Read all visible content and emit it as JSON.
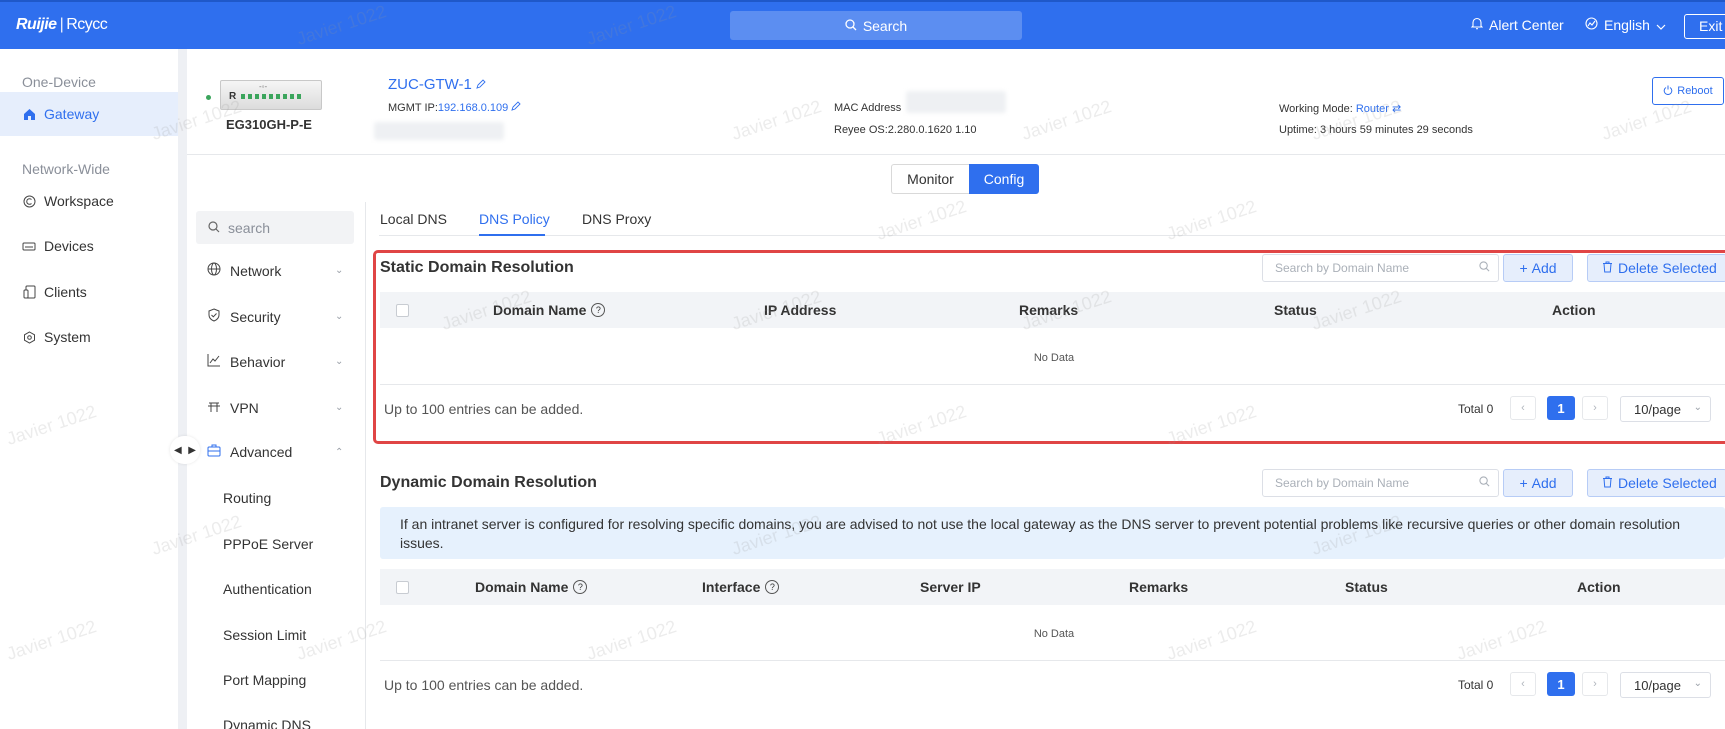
{
  "header": {
    "logo_brand": "Ruijie",
    "logo_sep": "|",
    "logo_sub": "Rcycc",
    "search_label": "Search",
    "alert_center": "Alert Center",
    "language": "English",
    "exit": "Exit"
  },
  "sidebar": {
    "group_one": "One-Device",
    "gateway": "Gateway",
    "group_network": "Network-Wide",
    "workspace": "Workspace",
    "devices": "Devices",
    "clients": "Clients",
    "system": "System"
  },
  "device": {
    "model": "EG310GH-P-E",
    "name": "ZUC-GTW-1",
    "mgmt_ip_label": "MGMT IP:",
    "mgmt_ip": "192.168.0.109",
    "mac_label": "MAC Address",
    "os_version": "Reyee OS:2.280.0.1620 1.10",
    "working_mode_label": "Working Mode:",
    "working_mode": "Router",
    "uptime": "Uptime: 3 hours 59 minutes 29 seconds",
    "reboot": "Reboot"
  },
  "mode_switch": {
    "monitor": "Monitor",
    "config": "Config"
  },
  "menu": {
    "search_placeholder": "search",
    "network": "Network",
    "security": "Security",
    "behavior": "Behavior",
    "vpn": "VPN",
    "advanced": "Advanced",
    "routing": "Routing",
    "pppoe": "PPPoE Server",
    "authentication": "Authentication",
    "session_limit": "Session Limit",
    "port_mapping": "Port Mapping",
    "dynamic_dns": "Dynamic DNS"
  },
  "tabs": {
    "local_dns": "Local DNS",
    "dns_policy": "DNS Policy",
    "dns_proxy": "DNS Proxy"
  },
  "static": {
    "title": "Static Domain Resolution",
    "search_placeholder": "Search by Domain Name",
    "add": "Add",
    "delete": "Delete Selected",
    "columns": [
      "Domain Name",
      "IP Address",
      "Remarks",
      "Status",
      "Action"
    ],
    "no_data": "No Data",
    "limit_note": "Up to 100 entries can be added.",
    "total": "Total 0",
    "page": "1",
    "page_size": "10/page"
  },
  "dynamic": {
    "title": "Dynamic Domain Resolution",
    "search_placeholder": "Search by Domain Name",
    "add": "Add",
    "delete": "Delete Selected",
    "info": "If an intranet server is configured for resolving specific domains, you are advised to not use the local gateway as the DNS server to prevent potential problems like recursive queries or other domain resolution issues.",
    "columns": [
      "Domain Name",
      "Interface",
      "Server IP",
      "Remarks",
      "Status",
      "Action"
    ],
    "no_data": "No Data",
    "limit_note": "Up to 100 entries can be added.",
    "total": "Total 0",
    "page": "1",
    "page_size": "10/page"
  },
  "watermark_text": "Javier 1022",
  "colors": {
    "brand": "#2f6fee",
    "highlight": "#e04545",
    "online": "#3ba55c"
  }
}
